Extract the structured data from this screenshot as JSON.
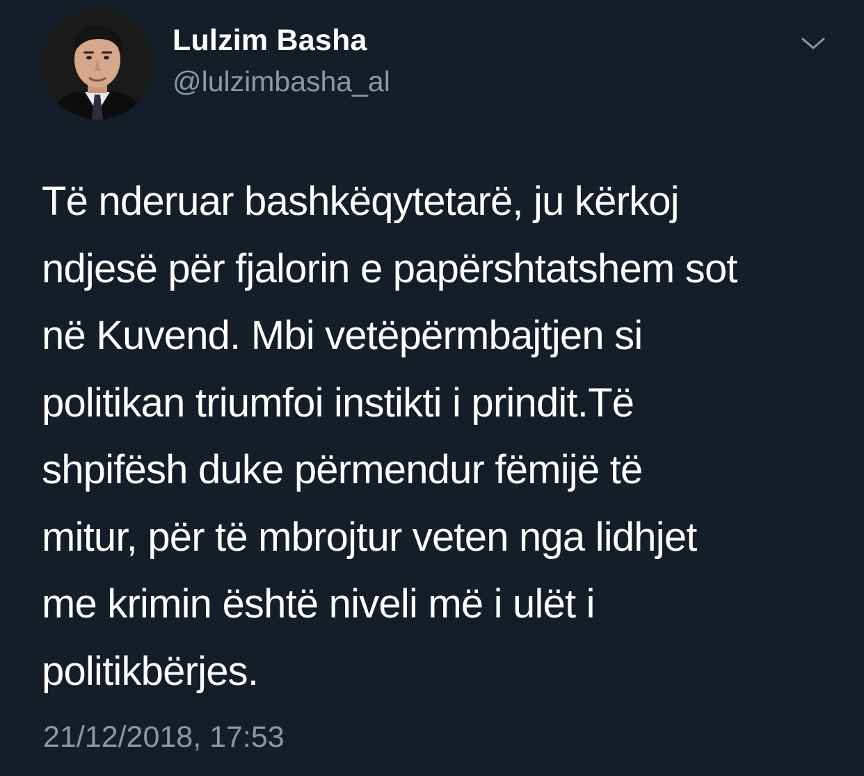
{
  "theme": {
    "background": "#151d29",
    "text_primary": "#ffffff",
    "text_secondary": "#8899a6"
  },
  "author": {
    "display_name": "Lulzim Basha",
    "handle": "@lulzimbasha_al",
    "avatar_icon": "profile-photo"
  },
  "tweet": {
    "lines": [
      "Të nderuar bashkëqytetarë, ju kërkoj",
      "ndjesë për fjalorin e papërshtatshem sot",
      "në Kuvend. Mbi vetëpërmbajtjen si",
      "politikan triumfoi instikti i prindit.Të",
      "shpifësh duke përmendur fëmijë të",
      "mitur, për të mbrojtur veten nga lidhjet",
      "me krimin është niveli më i ulët i",
      "politikbërjes."
    ],
    "timestamp": "21/12/2018, 17:53"
  },
  "menu": {
    "icon": "chevron-down-icon"
  }
}
